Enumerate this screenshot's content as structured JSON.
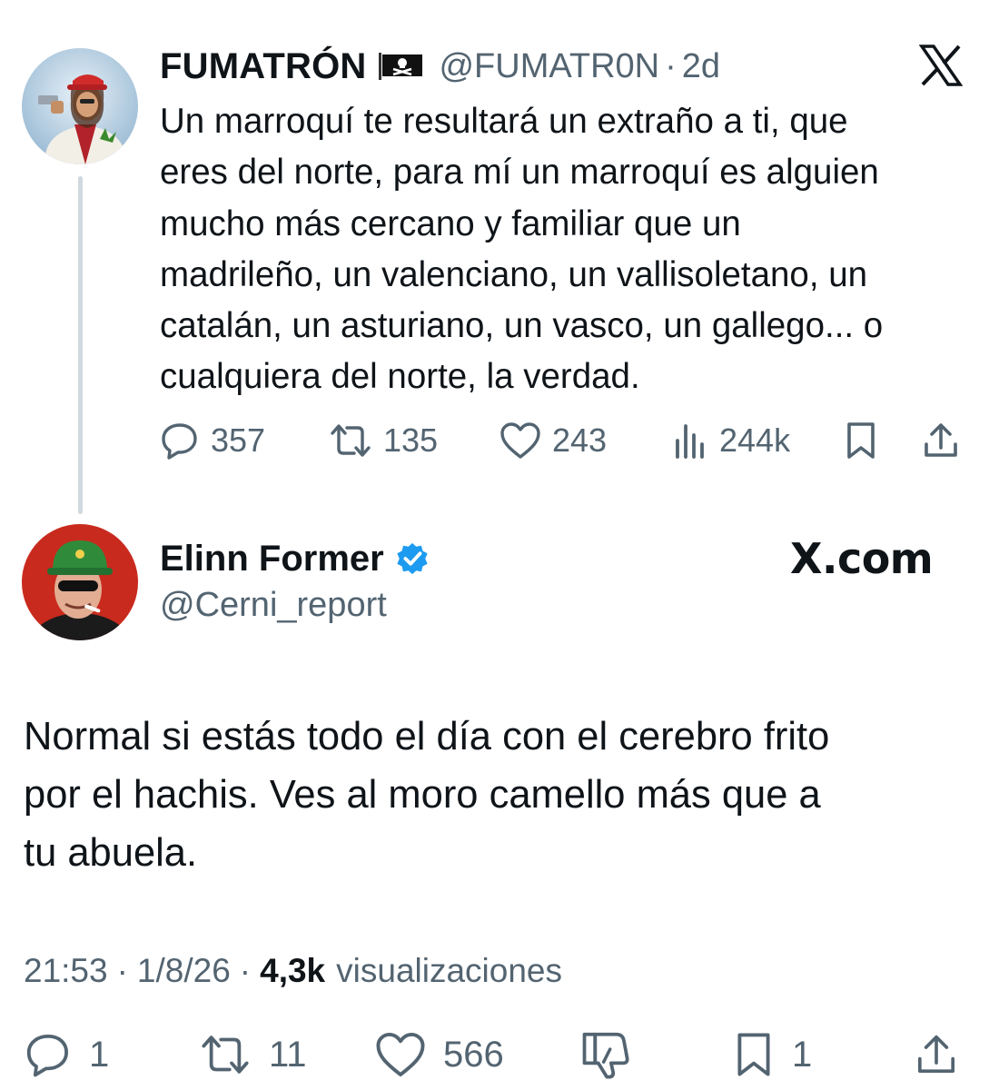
{
  "parent_tweet": {
    "author_name": "FUMATRÓN",
    "author_handle": "@FUMATR0N",
    "separator": "·",
    "time_ago": "2d",
    "badge_icon": "pirate-flag-icon",
    "text": "Un marroquí te resultará un extraño a ti, que\neres del norte, para mí un marroquí es alguien\nmucho más cercano y familiar que un\nmadrileño, un valenciano, un vallisoletano, un\ncatalán, un asturiano, un vasco, un gallego... o\ncualquiera del norte, la verdad.",
    "actions": {
      "replies": "357",
      "reposts": "135",
      "likes": "243",
      "views": "244k"
    }
  },
  "reply_tweet": {
    "author_name": "Elinn Former",
    "author_handle": "@Cerni_report",
    "verified": true,
    "watermark": "X.com",
    "text": "Normal si estás todo el día con el cerebro frito\npor el hachis. Ves al moro camello más que a\ntu abuela.",
    "time": "21:53",
    "date": "1/8/26",
    "separator": "·",
    "views_count": "4,3k",
    "views_label": "visualizaciones",
    "actions": {
      "replies": "1",
      "reposts": "11",
      "likes": "566",
      "bookmarks": "1"
    }
  },
  "colors": {
    "text": "#0f1419",
    "secondary": "#536471",
    "thread_line": "#cfd9de",
    "verified_blue": "#1d9bf0"
  }
}
